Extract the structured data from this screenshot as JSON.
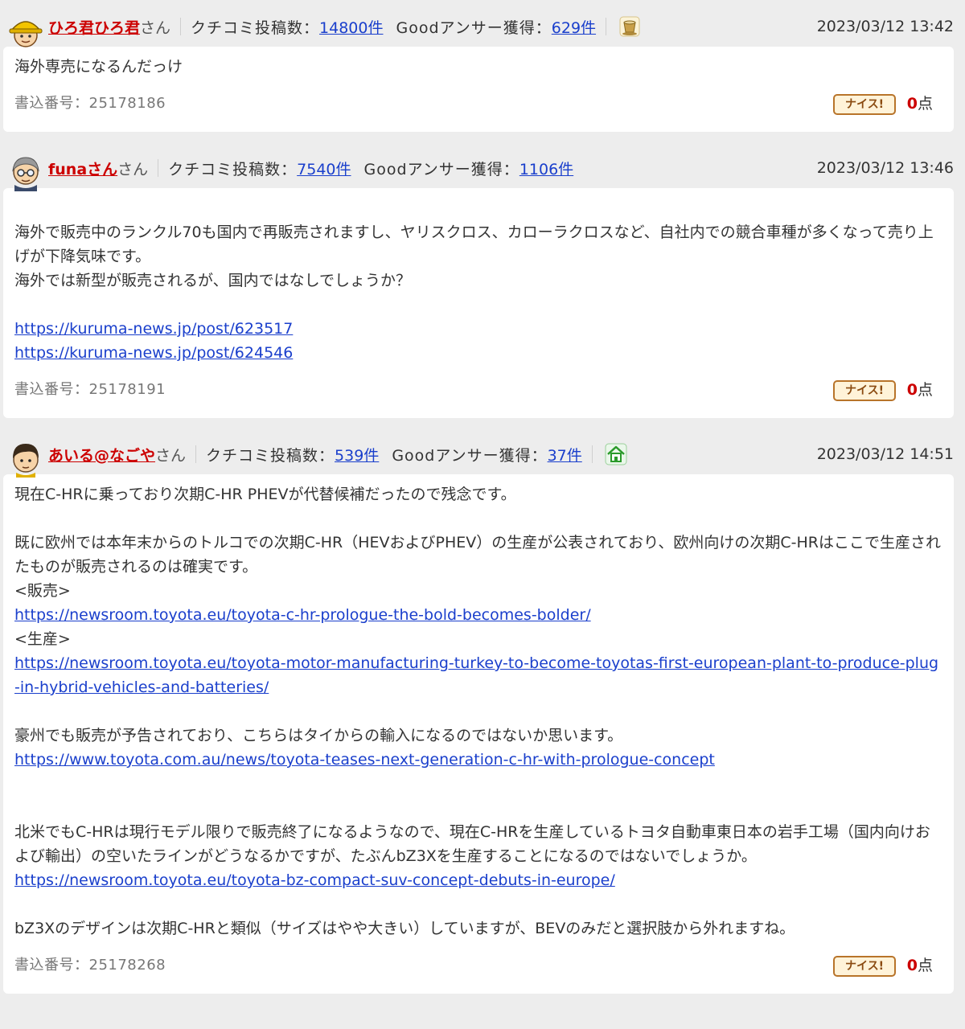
{
  "labels": {
    "san": "さん",
    "kuchikomi": "クチコミ投稿数：",
    "good": "Goodアンサー獲得：",
    "nice": "ナイス!",
    "point_unit": "点"
  },
  "posts": [
    {
      "username": "ひろ君ひろ君",
      "kuchikomi_count": "14800件",
      "good_count": "629件",
      "badge_icon": "tea-cup-icon",
      "timestamp": "2023/03/12 13:42",
      "lines": [
        {
          "text": "海外専売になるんだっけ",
          "link": false
        }
      ],
      "post_id": "書込番号：25178186",
      "nice_points": "0"
    },
    {
      "username": "funaさん",
      "kuchikomi_count": "7540件",
      "good_count": "1106件",
      "badge_icon": "",
      "timestamp": "2023/03/12 13:46",
      "lines": [
        {
          "text": "",
          "link": false
        },
        {
          "text": "海外で販売中のランクル70も国内で再販売されますし、ヤリスクロス、カローラクロスなど、自社内での競合車種が多くなって売り上げが下降気味です。",
          "link": false
        },
        {
          "text": "海外では新型が販売されるが、国内ではなしでしょうか？",
          "link": false
        },
        {
          "text": "",
          "link": false
        },
        {
          "text": "https://kuruma-news.jp/post/623517",
          "link": true
        },
        {
          "text": "https://kuruma-news.jp/post/624546",
          "link": true
        }
      ],
      "post_id": "書込番号：25178191",
      "nice_points": "0"
    },
    {
      "username": "あいる@なごや",
      "kuchikomi_count": "539件",
      "good_count": "37件",
      "badge_icon": "green-house-icon",
      "timestamp": "2023/03/12 14:51",
      "lines": [
        {
          "text": "現在C-HRに乗っており次期C-HR PHEVが代替候補だったので残念です。",
          "link": false
        },
        {
          "text": "",
          "link": false
        },
        {
          "text": "既に欧州では本年末からのトルコでの次期C-HR（HEVおよびPHEV）の生産が公表されており、欧州向けの次期C-HRはここで生産されたものが販売されるのは確実です。",
          "link": false
        },
        {
          "text": "<販売>",
          "link": false
        },
        {
          "text": "https://newsroom.toyota.eu/toyota-c-hr-prologue-the-bold-becomes-bolder/",
          "link": true
        },
        {
          "text": "<生産>",
          "link": false
        },
        {
          "text": "https://newsroom.toyota.eu/toyota-motor-manufacturing-turkey-to-become-toyotas-first-european-plant-to-produce-plug-in-hybrid-vehicles-and-batteries/",
          "link": true
        },
        {
          "text": "",
          "link": false
        },
        {
          "text": "豪州でも販売が予告されており、こちらはタイからの輸入になるのではないか思います。",
          "link": false
        },
        {
          "text": "https://www.toyota.com.au/news/toyota-teases-next-generation-c-hr-with-prologue-concept",
          "link": true
        },
        {
          "text": "",
          "link": false
        },
        {
          "text": "",
          "link": false
        },
        {
          "text": "北米でもC-HRは現行モデル限りで販売終了になるようなので、現在C-HRを生産しているトヨタ自動車東日本の岩手工場（国内向けおよび輸出）の空いたラインがどうなるかですが、たぶんbZ3Xを生産することになるのではないでしょうか。",
          "link": false
        },
        {
          "text": "https://newsroom.toyota.eu/toyota-bz-compact-suv-concept-debuts-in-europe/",
          "link": true
        },
        {
          "text": "",
          "link": false
        },
        {
          "text": "bZ3Xのデザインは次期C-HRと類似（サイズはやや大きい）していますが、BEVのみだと選択肢から外れますね。",
          "link": false
        }
      ],
      "post_id": "書込番号：25178268",
      "nice_points": "0"
    }
  ]
}
